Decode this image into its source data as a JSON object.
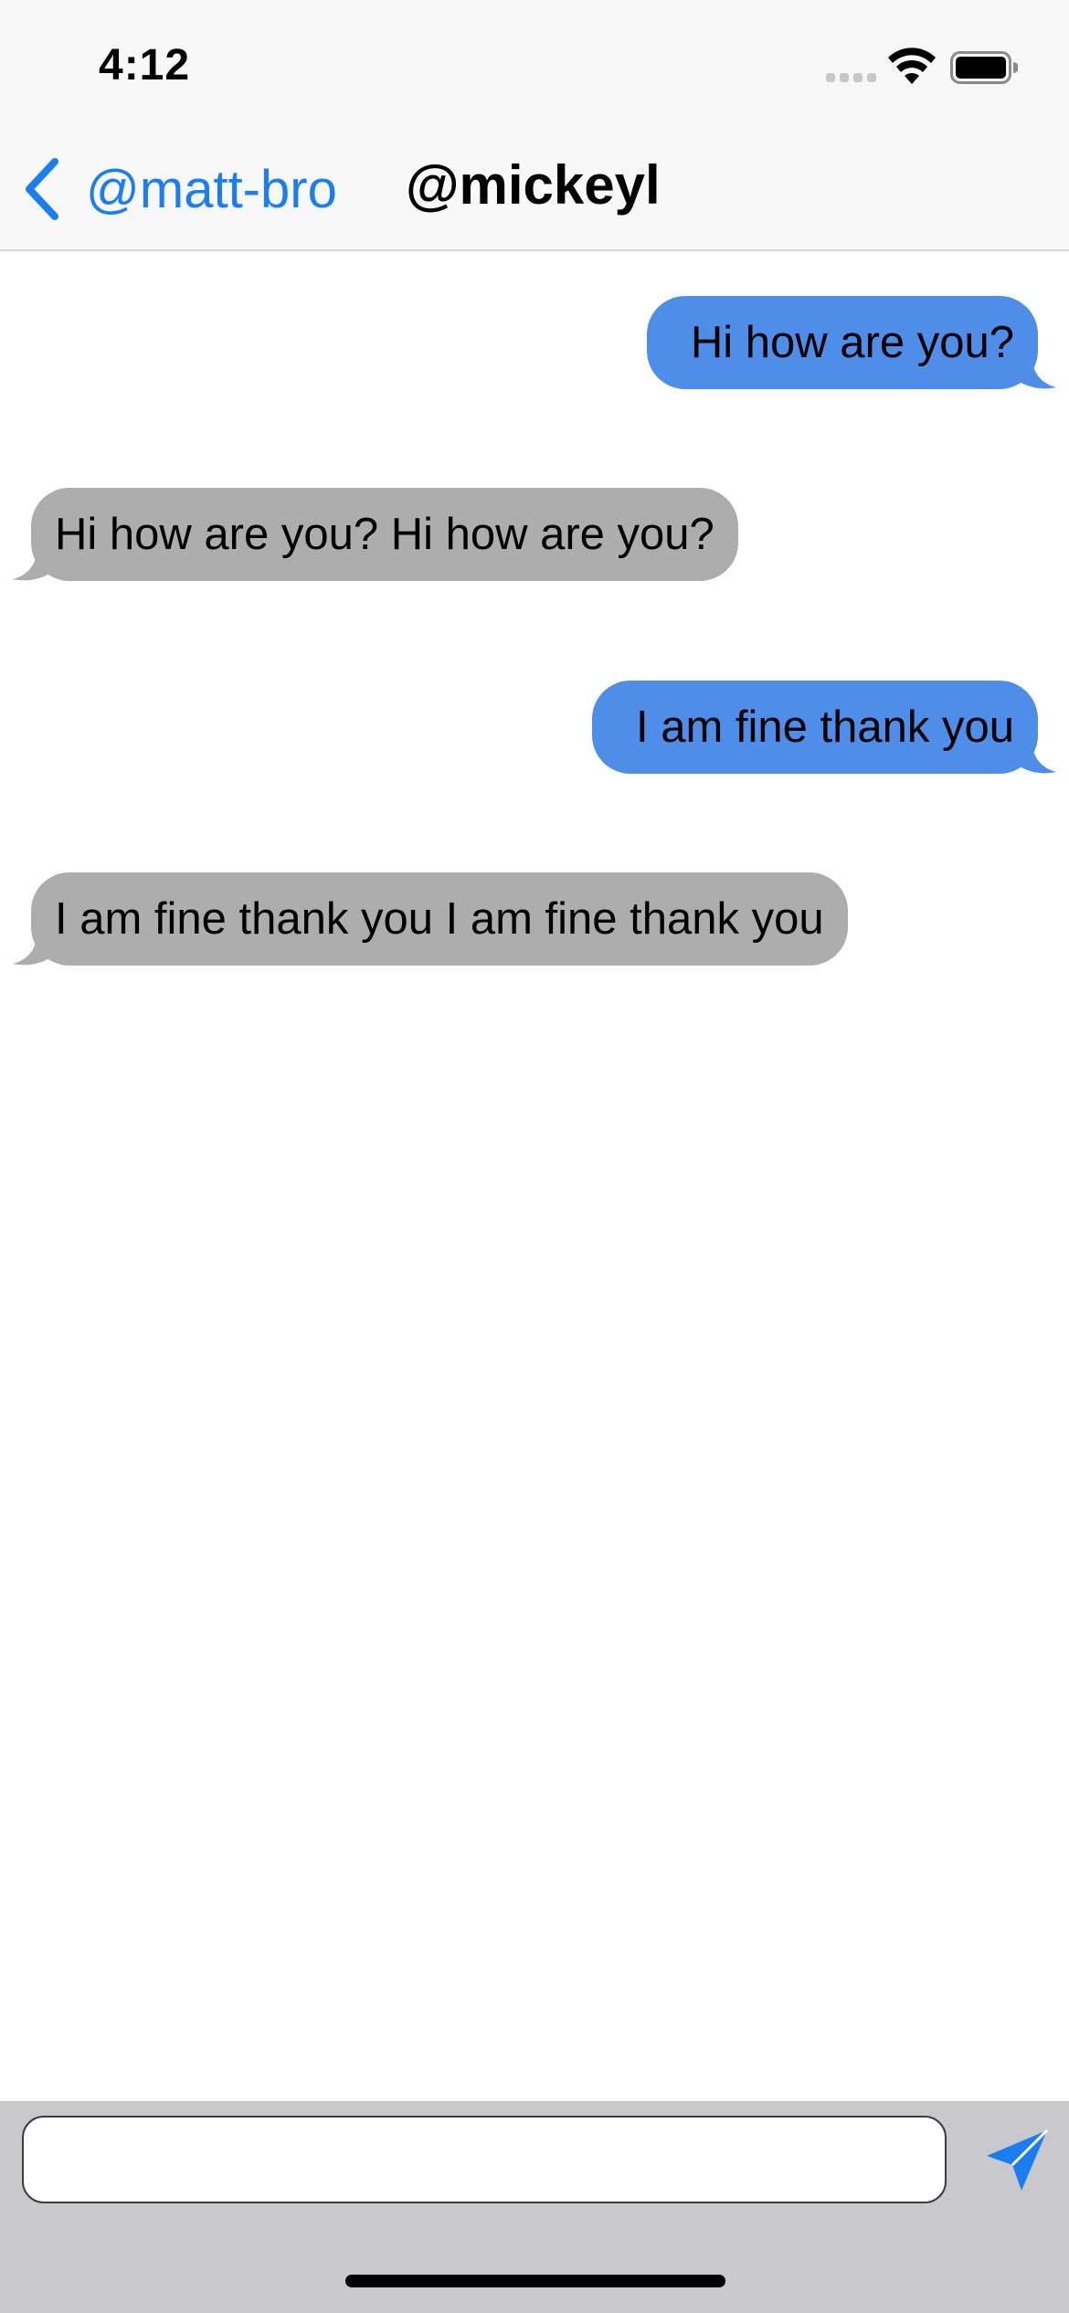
{
  "status_bar": {
    "time": "4:12"
  },
  "nav": {
    "back_label": "@matt-bro",
    "title": "@mickeyl"
  },
  "messages": [
    {
      "direction": "outgoing",
      "text": "Hi how are you?"
    },
    {
      "direction": "incoming",
      "text": "Hi how are you? Hi how are you?"
    },
    {
      "direction": "outgoing",
      "text": "I am fine thank you"
    },
    {
      "direction": "incoming",
      "text": "I am fine thank you I am fine thank you"
    }
  ],
  "composer": {
    "value": "",
    "placeholder": ""
  },
  "colors": {
    "accent": "#1a7ef2",
    "outgoing_bubble": "#4e8de8",
    "incoming_bubble": "#adadad",
    "input_bar": "#c8c8cd",
    "nav_background": "#f8f8f8"
  },
  "icons": {
    "back": "chevron-left-icon",
    "send": "paper-plane-icon",
    "wifi": "wifi-icon",
    "battery": "battery-icon",
    "signal": "cellular-signal-icon"
  }
}
